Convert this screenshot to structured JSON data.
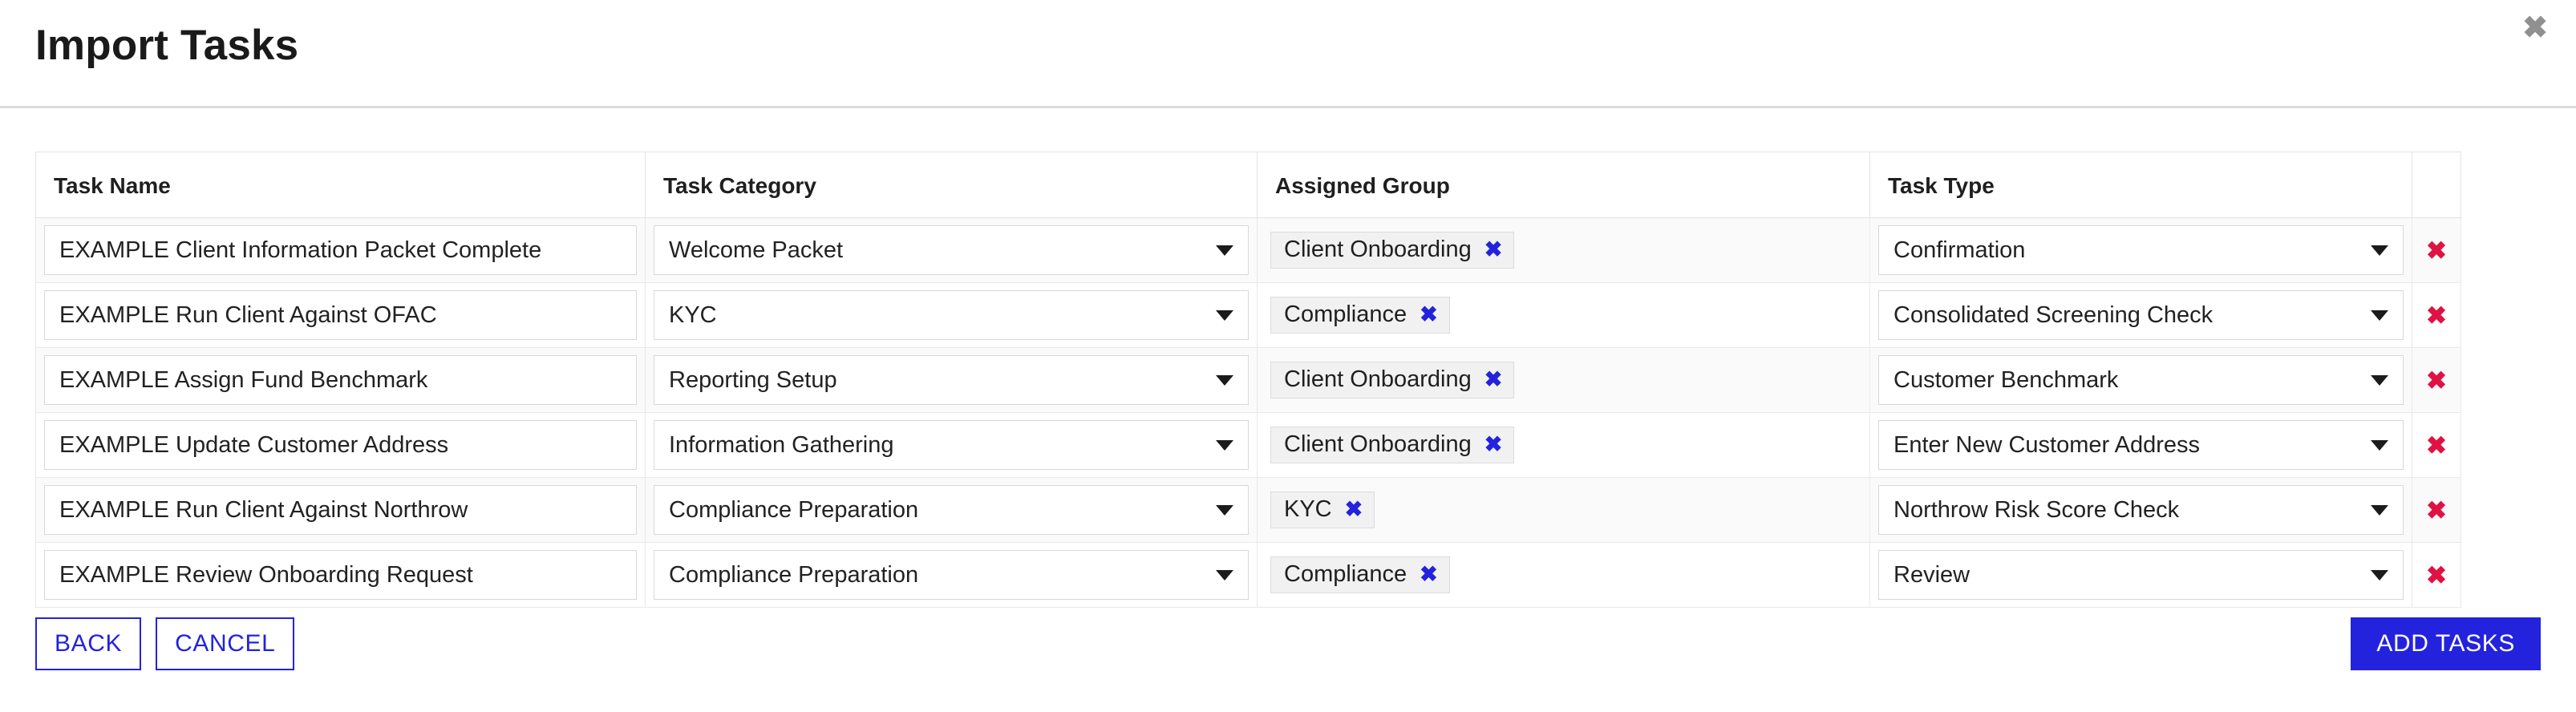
{
  "dialog": {
    "title": "Import Tasks",
    "close_icon": "close-icon",
    "close_glyph": "✖"
  },
  "table": {
    "columns": [
      {
        "key": "task_name",
        "label": "Task Name"
      },
      {
        "key": "task_category",
        "label": "Task Category"
      },
      {
        "key": "assigned_group",
        "label": "Assigned Group"
      },
      {
        "key": "task_type",
        "label": "Task Type"
      },
      {
        "key": "delete",
        "label": ""
      }
    ],
    "rows": [
      {
        "task_name": "EXAMPLE Client Information Packet Complete",
        "task_category": "Welcome Packet",
        "assigned_group": "Client Onboarding",
        "task_type": "Confirmation"
      },
      {
        "task_name": "EXAMPLE Run Client Against OFAC",
        "task_category": "KYC",
        "assigned_group": "Compliance",
        "task_type": "Consolidated Screening Check"
      },
      {
        "task_name": "EXAMPLE Assign Fund Benchmark",
        "task_category": "Reporting Setup",
        "assigned_group": "Client Onboarding",
        "task_type": "Customer Benchmark"
      },
      {
        "task_name": "EXAMPLE Update Customer Address",
        "task_category": "Information Gathering",
        "assigned_group": "Client Onboarding",
        "task_type": "Enter New Customer Address"
      },
      {
        "task_name": "EXAMPLE Run Client Against Northrow",
        "task_category": "Compliance Preparation",
        "assigned_group": "KYC",
        "task_type": "Northrow Risk Score Check"
      },
      {
        "task_name": "EXAMPLE Review Onboarding Request",
        "task_category": "Compliance Preparation",
        "assigned_group": "Compliance",
        "task_type": "Review"
      }
    ],
    "chip_remove_glyph": "✖",
    "delete_row_glyph": "✖",
    "caret_icon": "chevron-down-icon"
  },
  "footer": {
    "back_label": "BACK",
    "cancel_label": "CANCEL",
    "add_tasks_label": "ADD TASKS"
  },
  "colors": {
    "accent_blue": "#2323dd",
    "delete_red": "#e01243",
    "chip_background": "#f1f1f1",
    "row_stripe": "#fafafa",
    "border": "#e3e3e3"
  }
}
